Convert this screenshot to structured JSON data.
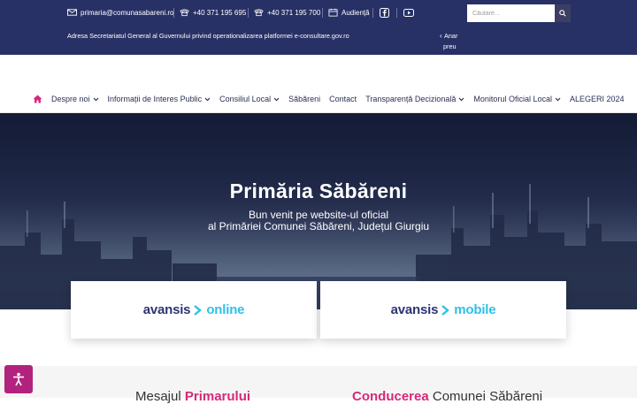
{
  "topbar": {
    "email": "primaria@comunasabareni.ro",
    "phone1": "+40 371 195 695",
    "phone2": "+40 371 195 700",
    "audience": "Audiență",
    "search_placeholder": "Căutare..."
  },
  "announcement": {
    "text": "Adresa Secretariatul General al Guvernului privind operationalizarea platformei e-consultare.gov.ro",
    "nav_line1": "Anar",
    "nav_line2": "preu"
  },
  "nav": {
    "items": [
      {
        "label": "Despre noi",
        "dropdown": true
      },
      {
        "label": "Informații de Interes Public",
        "dropdown": true
      },
      {
        "label": "Consiliul Local",
        "dropdown": true
      },
      {
        "label": "Săbăreni",
        "dropdown": false
      },
      {
        "label": "Contact",
        "dropdown": false
      },
      {
        "label": "Transparență Decizională",
        "dropdown": true
      },
      {
        "label": "Monitorul Oficial Local",
        "dropdown": true
      },
      {
        "label": "ALEGERI 2024",
        "dropdown": false
      }
    ]
  },
  "hero": {
    "title": "Primăria Săbăreni",
    "subtitle_line1": "Bun venit pe website-ul oficial",
    "subtitle_line2": "al Primăriei Comunei Săbăreni, Județul Giurgiu"
  },
  "cards": [
    {
      "brand": "avansis",
      "product": "online"
    },
    {
      "brand": "avansis",
      "product": "mobile"
    }
  ],
  "sections": {
    "mesaj_prefix": "Mesajul ",
    "mesaj_accent": "Primarului",
    "conducerea_accent": "Conducerea",
    "conducerea_suffix": " Comunei Săbăreni"
  },
  "colors": {
    "topbar_bg": "#283166",
    "accent_pink": "#d6287a",
    "brand_navy": "#2d3473",
    "brand_cyan": "#2ec1e8",
    "accessibility_button": "#b1237e"
  },
  "icons": [
    "email-icon",
    "phone-icon",
    "calendar-icon",
    "facebook-icon",
    "youtube-icon",
    "search-icon",
    "home-icon",
    "chevron-down-icon",
    "accessibility-icon"
  ]
}
